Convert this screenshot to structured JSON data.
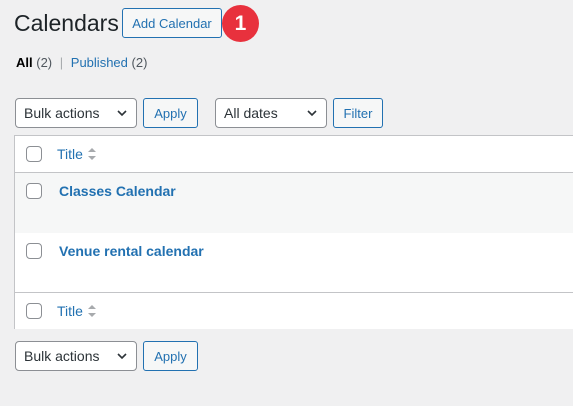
{
  "header": {
    "title": "Calendars",
    "add_button_label": "Add Calendar",
    "step_badge": "1"
  },
  "views": {
    "all_label": "All",
    "all_count": "(2)",
    "separator": "|",
    "published_label": "Published",
    "published_count": "(2)"
  },
  "top_nav": {
    "bulk_actions_selected": "Bulk actions",
    "apply_label": "Apply",
    "dates_selected": "All dates",
    "filter_label": "Filter"
  },
  "table": {
    "column_title": "Title",
    "rows": [
      {
        "title": "Classes Calendar"
      },
      {
        "title": "Venue rental calendar"
      }
    ]
  },
  "bottom_nav": {
    "bulk_actions_selected": "Bulk actions",
    "apply_label": "Apply"
  },
  "colors": {
    "accent": "#2271b1",
    "badge": "#e8313d",
    "background": "#f0f0f1"
  }
}
